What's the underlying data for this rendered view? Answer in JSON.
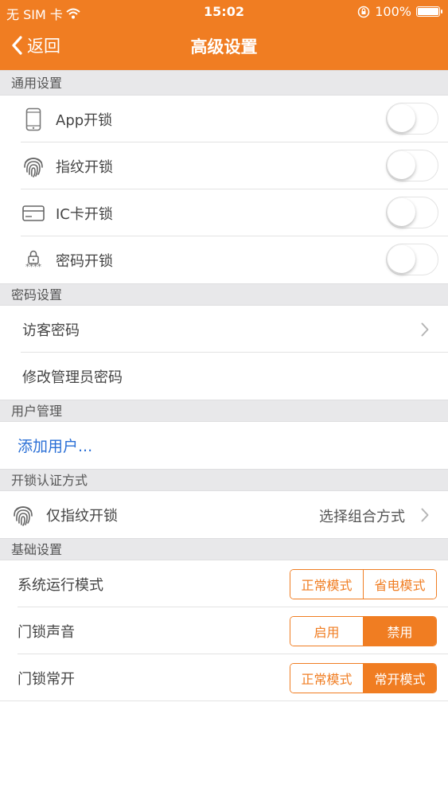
{
  "status_bar": {
    "carrier": "无 SIM 卡",
    "time": "15:02",
    "battery": "100%"
  },
  "nav": {
    "back_label": "返回",
    "title": "高级设置"
  },
  "sections": {
    "general": "通用设置",
    "password": "密码设置",
    "users": "用户管理",
    "auth": "开锁认证方式",
    "basic": "基础设置"
  },
  "general": {
    "app_unlock": "App开锁",
    "fingerprint_unlock": "指纹开锁",
    "ic_card_unlock": "IC卡开锁",
    "password_unlock": "密码开锁",
    "password_icon_caption": "****"
  },
  "password": {
    "visitor_password": "访客密码",
    "change_admin_password": "修改管理员密码"
  },
  "users": {
    "add_user": "添加用户..."
  },
  "auth": {
    "current_mode": "仅指纹开锁",
    "choose_combo": "选择组合方式"
  },
  "basic": {
    "run_mode_label": "系统运行模式",
    "run_mode_options": [
      "正常模式",
      "省电模式"
    ],
    "sound_label": "门锁声音",
    "sound_options": [
      "启用",
      "禁用"
    ],
    "always_open_label": "门锁常开",
    "always_open_options": [
      "正常模式",
      "常开模式"
    ]
  },
  "colors": {
    "accent": "#f07d22",
    "link": "#2a6fd6",
    "section_bg": "#e8e8ea"
  }
}
